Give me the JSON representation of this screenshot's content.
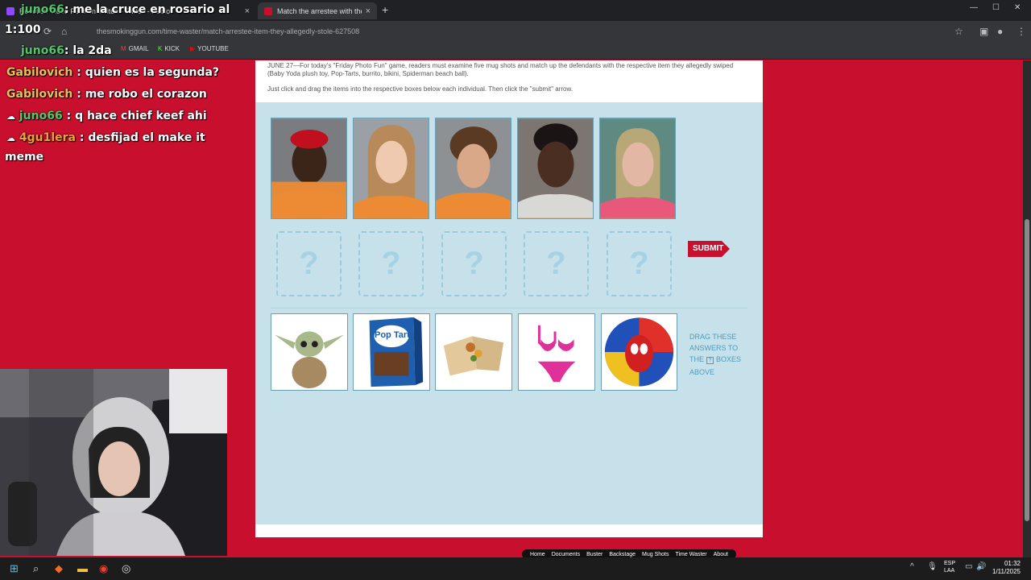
{
  "browser": {
    "tabs": [
      {
        "label": "Reaction Video Pero en Twitch - Twitch - Pablo"
      },
      {
        "label": "Match the arrestee with the item"
      }
    ],
    "url": "thesmokinggun.com/time-waster/match-arrestee-item-they-allegedly-stole-627508",
    "bookmarks": [
      "GMAIL",
      "KICK",
      "YOUTUBE"
    ]
  },
  "chat": [
    {
      "user": "juno66",
      "message": ": me la cruce en rosario al"
    },
    {
      "user": "1:100",
      "message": ""
    },
    {
      "user": "juno66",
      "message": ": la 2da"
    },
    {
      "user": "Gabilovich",
      "message": ": quien es la segunda?"
    },
    {
      "user": "Gabilovich",
      "message": ": me robo el corazon"
    },
    {
      "user": "juno66",
      "message": ": q hace chief keef ahi"
    },
    {
      "user": "4gu1lera",
      "message": ": desfijad el make it"
    },
    {
      "user": "",
      "message": "meme"
    }
  ],
  "page": {
    "intro_line1": "JUNE 27—For today's \"Friday Photo Fun\" game, readers must examine five mug shots and match up the defendants with the respective item they allegedly swiped",
    "intro_line1b": "(Baby Yoda plush toy, Pop-Tarts, burrito, bikini, Spiderman beach ball).",
    "intro_line2": "Just click and drag the items into the respective boxes below each individual. Then click the \"submit\" arrow.",
    "drop_placeholder": "?",
    "submit_label": "SUBMIT",
    "drag_hint_1": "DRAG THESE",
    "drag_hint_2": "ANSWERS TO",
    "drag_hint_3": "THE",
    "drag_hint_4": "BOXES",
    "drag_hint_5": "ABOVE",
    "items": [
      "Baby Yoda plush toy",
      "Pop-Tarts",
      "burrito",
      "bikini",
      "Spiderman beach ball"
    ],
    "item_text_poptarts": "Pop Tarts",
    "footer_nav": [
      "Home",
      "Documents",
      "Buster",
      "Backstage",
      "Mug Shots",
      "Time Waster",
      "About"
    ]
  },
  "taskbar": {
    "lang": [
      "ESP",
      "LAA"
    ],
    "time": "01:32",
    "date": "1/11/2025"
  }
}
